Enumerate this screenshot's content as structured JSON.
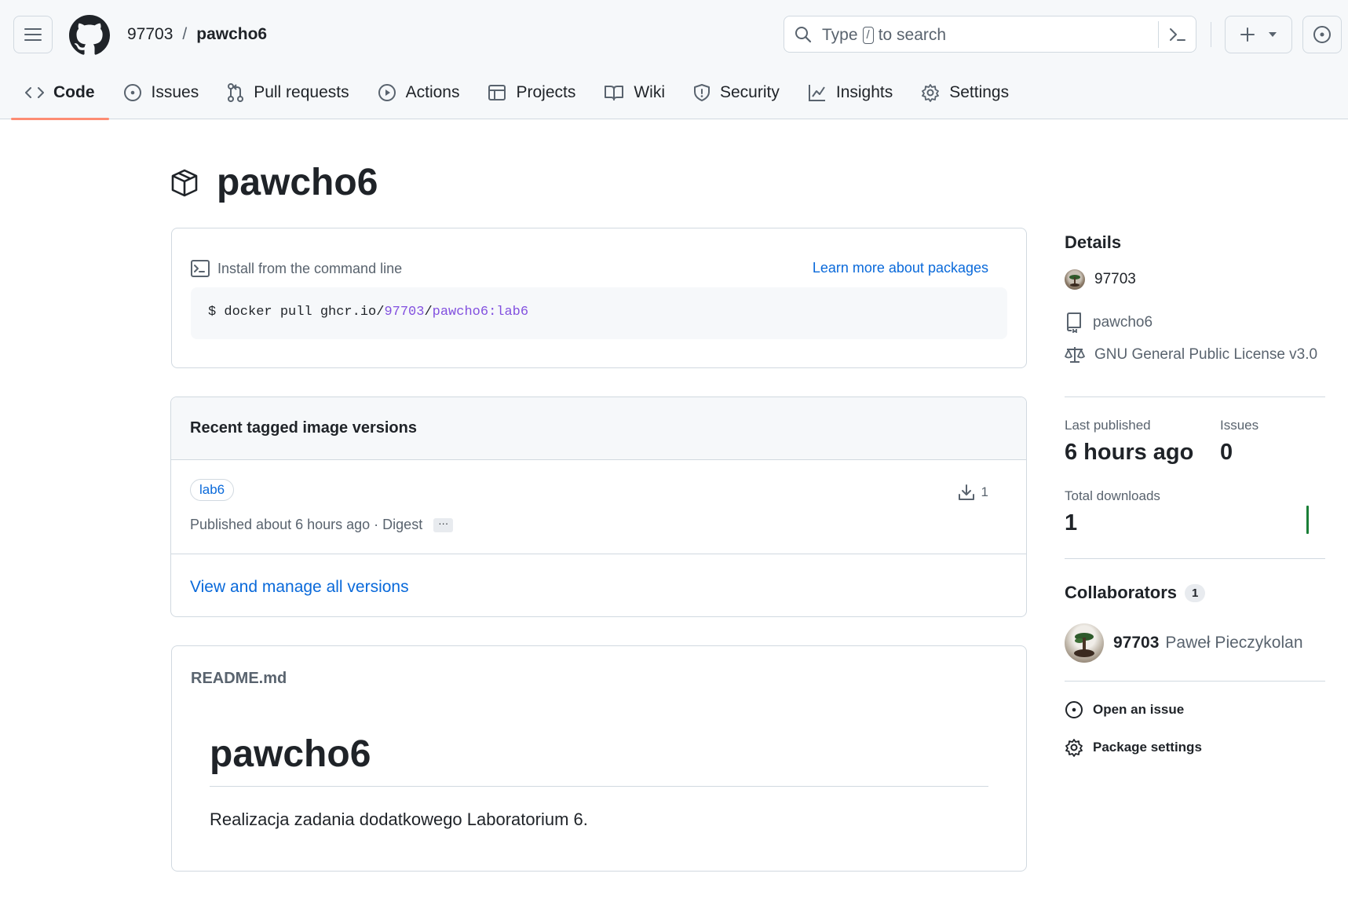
{
  "header": {
    "owner": "97703",
    "separator": "/",
    "repo": "pawcho6",
    "search": {
      "prefix": "Type",
      "key": "/",
      "suffix": "to search"
    }
  },
  "tabs": [
    {
      "label": "Code",
      "icon": "code-icon",
      "active": true
    },
    {
      "label": "Issues",
      "icon": "issue-opened-icon"
    },
    {
      "label": "Pull requests",
      "icon": "git-pull-request-icon"
    },
    {
      "label": "Actions",
      "icon": "play-icon"
    },
    {
      "label": "Projects",
      "icon": "table-icon"
    },
    {
      "label": "Wiki",
      "icon": "book-icon"
    },
    {
      "label": "Security",
      "icon": "shield-icon"
    },
    {
      "label": "Insights",
      "icon": "graph-icon"
    },
    {
      "label": "Settings",
      "icon": "gear-icon"
    }
  ],
  "package": {
    "name": "pawcho6"
  },
  "install": {
    "label": "Install from the command line",
    "learn_more": "Learn more about packages",
    "command_prefix": "$ docker pull ghcr.io/",
    "command_owner": "97703",
    "command_sep": "/",
    "command_image": "pawcho6:lab6"
  },
  "versions": {
    "heading": "Recent tagged image versions",
    "items": [
      {
        "tag": "lab6",
        "downloads": "1",
        "published": "Published about 6 hours ago · Digest",
        "digest_toggle": "···"
      }
    ],
    "view_all": "View and manage all versions"
  },
  "readme": {
    "filename": "README.md",
    "title": "pawcho6",
    "description": "Realizacja zadania dodatkowego Laboratorium 6."
  },
  "sidebar": {
    "details_heading": "Details",
    "owner": "97703",
    "repository": "pawcho6",
    "license": "GNU General Public License v3.0",
    "last_published_label": "Last published",
    "last_published_value": "6 hours ago",
    "issues_label": "Issues",
    "issues_value": "0",
    "total_downloads_label": "Total downloads",
    "total_downloads_value": "1",
    "collaborators_heading": "Collaborators",
    "collaborators_count": "1",
    "collaborator_login": "97703",
    "collaborator_name": "Paweł Pieczykolan",
    "open_issue": "Open an issue",
    "package_settings": "Package settings",
    "sparkline_color": "#1a7f37"
  },
  "colors": {
    "accent_link": "#0969da",
    "active_tab_underline": "#fd8c73",
    "code_highlight": "#8250df"
  }
}
